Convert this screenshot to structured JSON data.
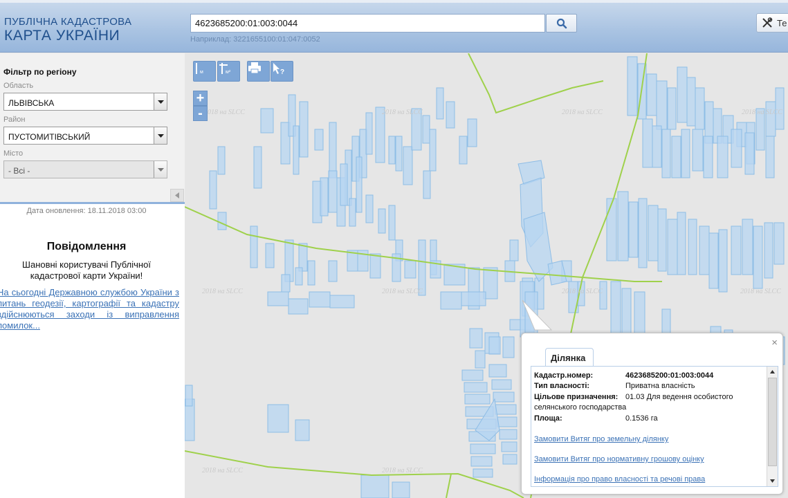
{
  "header": {
    "logo_line1": "ПУБЛІЧНА КАДАСТРОВА",
    "logo_line2": "КАРТА УКРАЇНИ",
    "search_value": "4623685200:01:003:0044",
    "search_example": "Наприклад: 3221655100:01:047:0052",
    "tools_label": "Те",
    "colors": {
      "header_bg": "#a9c3e2",
      "logo": "#1f4f8c"
    }
  },
  "sidebar": {
    "filter_title": "Фільтр по регіону",
    "oblast_label": "Область",
    "oblast_value": "ЛЬВІВСЬКА",
    "raion_label": "Район",
    "raion_value": "ПУСТОМИТІВСЬКИЙ",
    "misto_label": "Місто",
    "misto_value": "- Всі -",
    "update_date": "Дата оновлення: 18.11.2018 03:00",
    "message_title": "Повідомлення",
    "message_text": "Шановні користувачі Публічної кадастрової карти України!",
    "message_link": "На сьогодні Державною службою України з питань геодезії, картографії та кадастру здійснюються заходи із виправлення помилок..."
  },
  "map": {
    "watermark": "2018 на SLCC",
    "parcel_color": "#b7d6f1",
    "road_color": "#9fd14b",
    "tools": [
      "ruler-m-icon",
      "ruler-area-icon",
      "print-icon",
      "identify-icon"
    ],
    "zoom_in": "+",
    "zoom_out": "-"
  },
  "popup": {
    "tab": "Ділянка",
    "rows": [
      {
        "k": "Кадастр.номер:",
        "v": "4623685200:01:003:0044"
      },
      {
        "k": "Тип власності:",
        "v": "Приватна власність"
      },
      {
        "k": "Цільове призначення:",
        "v": "01.03 Для ведення особистого"
      },
      {
        "k": "",
        "v": "селянського господарства"
      },
      {
        "k": "Площа:",
        "v": "0.1536 га"
      }
    ],
    "links": [
      "Замовити Витяг про земельну ділянку",
      "Замовити Витяг про нормативну грошову оцінку",
      "Інформація про право власності та речові права"
    ],
    "close": "×"
  }
}
